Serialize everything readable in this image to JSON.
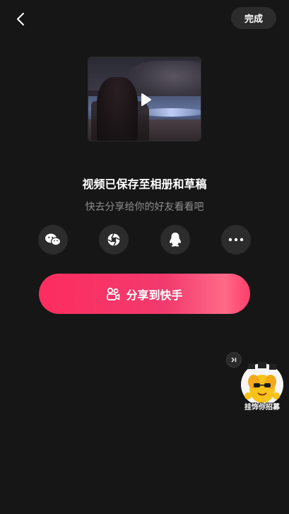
{
  "header": {
    "back_icon": "chevron-left-icon",
    "done_label": "完成"
  },
  "preview": {
    "play_icon": "play-icon"
  },
  "message": {
    "title": "视频已保存至相册和草稿",
    "subtitle": "快去分享给你的好友看看吧"
  },
  "share_targets": [
    {
      "icon": "wechat-icon"
    },
    {
      "icon": "moments-icon"
    },
    {
      "icon": "qq-icon"
    },
    {
      "icon": "more-icon"
    }
  ],
  "primary_action": {
    "icon": "kuaishou-icon",
    "label": "分享到快手",
    "gradient": [
      "#fd2d5f",
      "#ff6a88"
    ]
  },
  "promo": {
    "skip_icon": "skip-icon",
    "caption": "挂饰你招募"
  },
  "colors": {
    "background": "#161616",
    "button_bg": "#2c2c2c",
    "accent": "#fd2d5f",
    "subtitle": "#8e8e8e"
  }
}
